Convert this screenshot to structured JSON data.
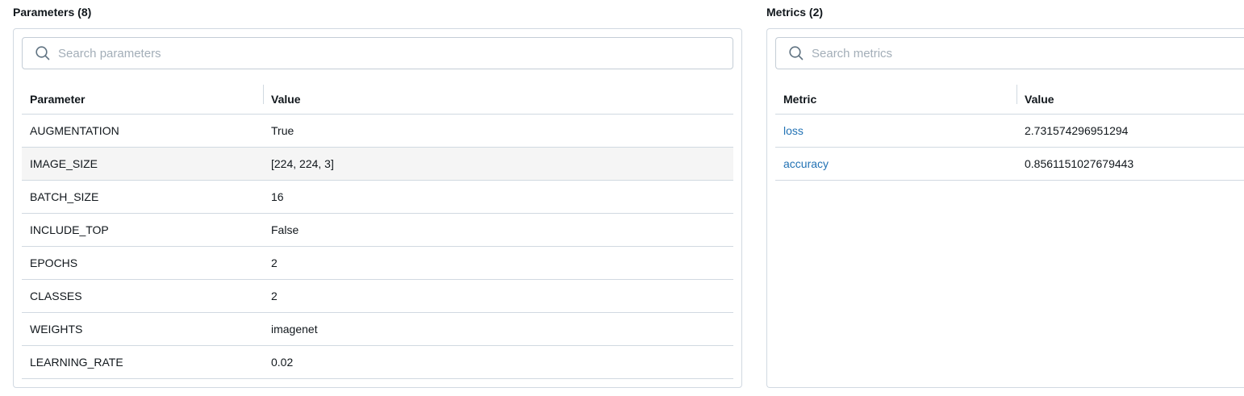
{
  "params": {
    "title": "Parameters (8)",
    "search_placeholder": "Search parameters",
    "headers": {
      "name": "Parameter",
      "value": "Value"
    },
    "rows": [
      {
        "name": "AUGMENTATION",
        "value": "True"
      },
      {
        "name": "IMAGE_SIZE",
        "value": "[224, 224, 3]"
      },
      {
        "name": "BATCH_SIZE",
        "value": "16"
      },
      {
        "name": "INCLUDE_TOP",
        "value": "False"
      },
      {
        "name": "EPOCHS",
        "value": "2"
      },
      {
        "name": "CLASSES",
        "value": "2"
      },
      {
        "name": "WEIGHTS",
        "value": "imagenet"
      },
      {
        "name": "LEARNING_RATE",
        "value": "0.02"
      }
    ]
  },
  "metrics": {
    "title": "Metrics (2)",
    "search_placeholder": "Search metrics",
    "headers": {
      "name": "Metric",
      "value": "Value"
    },
    "rows": [
      {
        "name": "loss",
        "value": "2.731574296951294"
      },
      {
        "name": "accuracy",
        "value": "0.8561151027679443"
      }
    ]
  },
  "colors": {
    "link": "#2272b4",
    "border": "#d1d9e1",
    "hover_row": "#f5f5f5",
    "placeholder": "#a3aeb8"
  },
  "icons": {
    "search": "search-icon"
  }
}
